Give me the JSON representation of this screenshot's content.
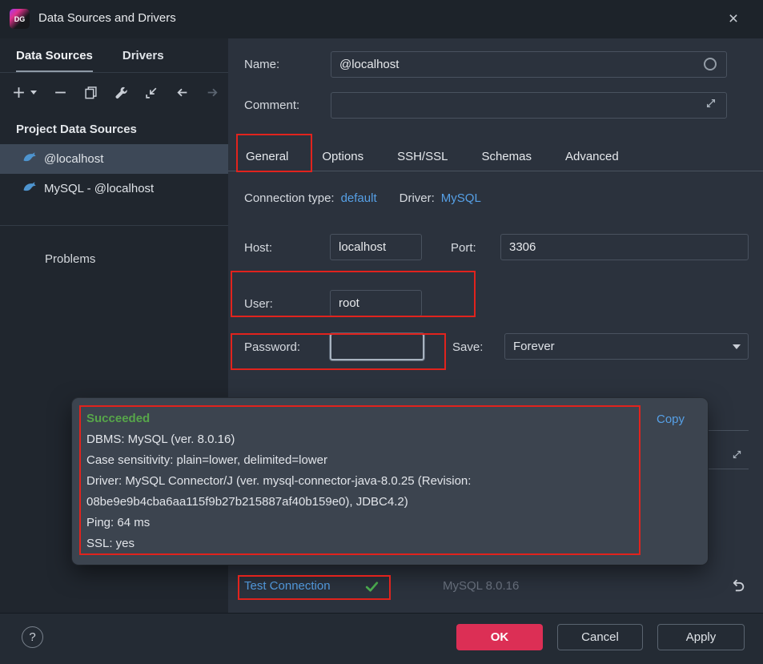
{
  "window": {
    "title": "Data Sources and Drivers",
    "close_glyph": "×"
  },
  "colors": {
    "annotation_red": "#e1231d",
    "link_blue": "#56a0e6",
    "success_green": "#57a64a",
    "ok_button_red": "#dc2f55"
  },
  "sidebar": {
    "tabs": [
      {
        "label": "Data Sources"
      },
      {
        "label": "Drivers"
      }
    ],
    "toolbar_icons": [
      "add",
      "add-dropdown",
      "remove",
      "duplicate",
      "edit-properties",
      "import",
      "back",
      "forward"
    ],
    "section_title": "Project Data Sources",
    "items": [
      {
        "label": "@localhost"
      },
      {
        "label": "MySQL - @localhost"
      }
    ],
    "problems_label": "Problems"
  },
  "form": {
    "name_label": "Name:",
    "name_value": "@localhost",
    "comment_label": "Comment:",
    "comment_value": "",
    "tabs": [
      {
        "label": "General"
      },
      {
        "label": "Options"
      },
      {
        "label": "SSH/SSL"
      },
      {
        "label": "Schemas"
      },
      {
        "label": "Advanced"
      }
    ],
    "connection_type_label": "Connection type:",
    "connection_type_value": "default",
    "driver_label": "Driver:",
    "driver_value": "MySQL",
    "host_label": "Host:",
    "host_value": "localhost",
    "port_label": "Port:",
    "port_value": "3306",
    "user_label": "User:",
    "user_value": "root",
    "password_label": "Password:",
    "password_value": "",
    "save_label": "Save:",
    "save_value": "Forever"
  },
  "result_popup": {
    "status": "Succeeded",
    "copy_label": "Copy",
    "lines": [
      "DBMS: MySQL (ver. 8.0.16)",
      "Case sensitivity: plain=lower, delimited=lower",
      "Driver: MySQL Connector/J (ver. mysql-connector-java-8.0.25 (Revision:",
      "08be9e9b4cba6aa115f9b27b215887af40b159e0), JDBC4.2)",
      "Ping: 64 ms",
      "SSL: yes"
    ]
  },
  "footer": {
    "test_connection_label": "Test Connection",
    "dbms_version": "MySQL 8.0.16",
    "help_label": "?",
    "ok_label": "OK",
    "cancel_label": "Cancel",
    "apply_label": "Apply"
  }
}
